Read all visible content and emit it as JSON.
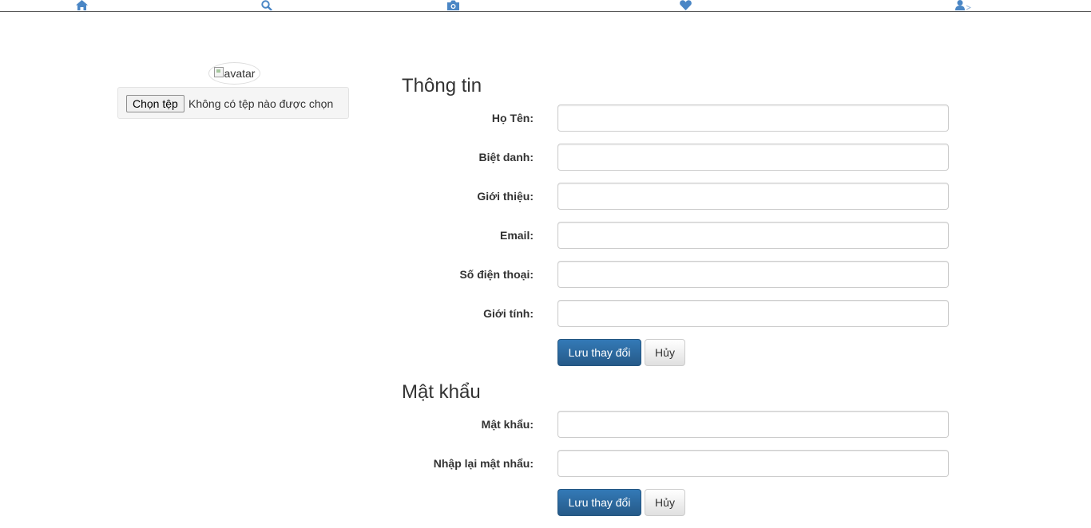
{
  "nav": {
    "icons": [
      "home-icon",
      "search-icon",
      "camera-icon",
      "heart-icon",
      "user-icon"
    ],
    "accent": "#4a86c5"
  },
  "avatar": {
    "alt": "avatar"
  },
  "file_upload": {
    "button_label": "Chọn tệp",
    "status": "Không có tệp nào được chọn"
  },
  "info": {
    "title": "Thông tin",
    "fields": [
      {
        "label": "Họ Tên:",
        "value": ""
      },
      {
        "label": "Biệt danh:",
        "value": ""
      },
      {
        "label": "Giới thiệu:",
        "value": ""
      },
      {
        "label": "Email:",
        "value": ""
      },
      {
        "label": "Số điện thoại:",
        "value": ""
      },
      {
        "label": "Giới tính:",
        "value": ""
      }
    ],
    "save_label": "Lưu thay đổi",
    "cancel_label": "Hủy"
  },
  "password": {
    "title": "Mật khẩu",
    "fields": [
      {
        "label": "Mật khẩu:",
        "value": ""
      },
      {
        "label": "Nhập lại mật nhẩu:",
        "value": ""
      }
    ],
    "save_label": "Lưu thay đổi",
    "cancel_label": "Hủy"
  },
  "colors": {
    "primary": "#337ab7",
    "primary_dark": "#265a88"
  }
}
